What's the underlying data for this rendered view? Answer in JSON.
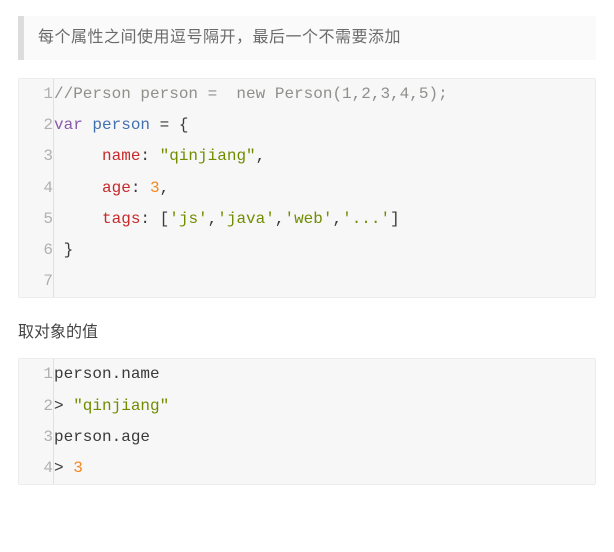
{
  "blockquote": {
    "text": "每个属性之间使用逗号隔开，最后一个不需要添加"
  },
  "code1": {
    "lines": [
      {
        "n": "1",
        "tokens": [
          {
            "t": "//Person person =  new Person(1,2,3,4,5);",
            "cls": "c-comment"
          }
        ]
      },
      {
        "n": "2",
        "tokens": [
          {
            "t": "var",
            "cls": "c-keyword"
          },
          {
            "t": " ",
            "cls": ""
          },
          {
            "t": "person",
            "cls": "c-varname"
          },
          {
            "t": " = {",
            "cls": "c-punct"
          }
        ]
      },
      {
        "n": "3",
        "tokens": [
          {
            "t": "     ",
            "cls": ""
          },
          {
            "t": "name",
            "cls": "c-prop"
          },
          {
            "t": ": ",
            "cls": "c-punct"
          },
          {
            "t": "\"qinjiang\"",
            "cls": "c-string"
          },
          {
            "t": ",",
            "cls": "c-punct"
          }
        ]
      },
      {
        "n": "4",
        "tokens": [
          {
            "t": "     ",
            "cls": ""
          },
          {
            "t": "age",
            "cls": "c-prop"
          },
          {
            "t": ": ",
            "cls": "c-punct"
          },
          {
            "t": "3",
            "cls": "c-num"
          },
          {
            "t": ",",
            "cls": "c-punct"
          }
        ]
      },
      {
        "n": "5",
        "tokens": [
          {
            "t": "     ",
            "cls": ""
          },
          {
            "t": "tags",
            "cls": "c-prop"
          },
          {
            "t": ": [",
            "cls": "c-punct"
          },
          {
            "t": "'js'",
            "cls": "c-string"
          },
          {
            "t": ",",
            "cls": "c-punct"
          },
          {
            "t": "'java'",
            "cls": "c-string"
          },
          {
            "t": ",",
            "cls": "c-punct"
          },
          {
            "t": "'web'",
            "cls": "c-string"
          },
          {
            "t": ",",
            "cls": "c-punct"
          },
          {
            "t": "'...'",
            "cls": "c-string"
          },
          {
            "t": "]",
            "cls": "c-punct"
          }
        ]
      },
      {
        "n": "6",
        "tokens": [
          {
            "t": " }",
            "cls": "c-punct"
          }
        ]
      },
      {
        "n": "7",
        "tokens": [
          {
            "t": "",
            "cls": ""
          }
        ]
      }
    ]
  },
  "heading2": {
    "text": "取对象的值"
  },
  "code2": {
    "lines": [
      {
        "n": "1",
        "tokens": [
          {
            "t": "person.name",
            "cls": "c-punct"
          }
        ]
      },
      {
        "n": "2",
        "tokens": [
          {
            "t": "> ",
            "cls": "c-punct"
          },
          {
            "t": "\"qinjiang\"",
            "cls": "c-string"
          }
        ]
      },
      {
        "n": "3",
        "tokens": [
          {
            "t": "person.age",
            "cls": "c-punct"
          }
        ]
      },
      {
        "n": "4",
        "tokens": [
          {
            "t": "> ",
            "cls": "c-punct"
          },
          {
            "t": "3",
            "cls": "c-num"
          }
        ]
      }
    ]
  }
}
